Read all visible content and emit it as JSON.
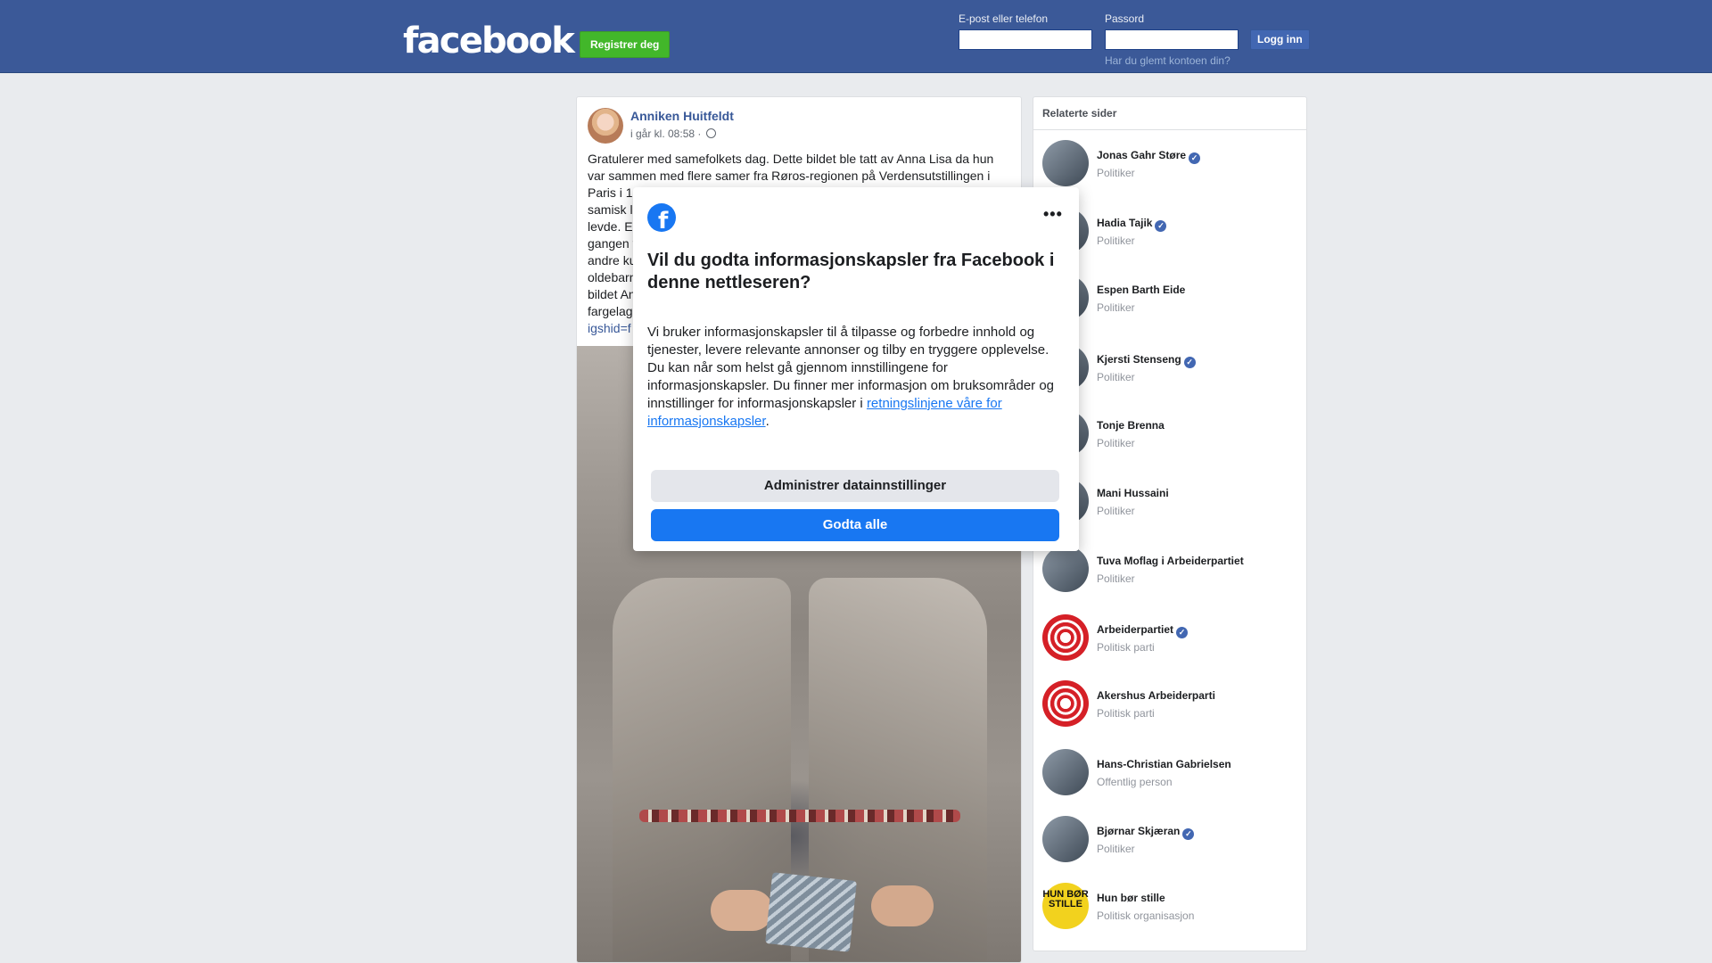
{
  "header": {
    "logo_text": "facebook",
    "register_label": "Registrer deg",
    "email_label": "E-post eller telefon",
    "password_label": "Passord",
    "login_label": "Logg inn",
    "forgot_label": "Har du glemt kontoen din?"
  },
  "post": {
    "author": "Anniken Huitfeldt",
    "time": "i går kl. 08:58 ·",
    "text_visible": "Gratulerer med samefolkets dag. Dette bildet ble tatt av Anna Lisa da hun var sammen med flere samer fra Røros-regionen på Verdensutstillingen i Paris i 18",
    "text_fragments": [
      "samisk l",
      "levde. E",
      "gangen v",
      "andre ku",
      "oldebarn",
      "bildet An",
      "fargelag"
    ],
    "link_fragment": "igshid=f"
  },
  "sidebar": {
    "title": "Relaterte sider",
    "items": [
      {
        "name": "Jonas Gahr Støre",
        "sub": "Politiker",
        "verified": true
      },
      {
        "name": "Hadia Tajik",
        "sub": "Politiker",
        "verified": true
      },
      {
        "name": "Espen Barth Eide",
        "sub": "Politiker",
        "verified": false
      },
      {
        "name": "Kjersti Stenseng",
        "sub": "Politiker",
        "verified": true
      },
      {
        "name": "Tonje Brenna",
        "sub": "Politiker",
        "verified": false
      },
      {
        "name": "Mani Hussaini",
        "sub": "Politiker",
        "verified": false
      },
      {
        "name": "Tuva Moflag i Arbeiderpartiet",
        "sub": "Politiker",
        "verified": false
      },
      {
        "name": "Arbeiderpartiet",
        "sub": "Politisk parti",
        "verified": true
      },
      {
        "name": "Akershus Arbeiderparti",
        "sub": "Politisk parti",
        "verified": false
      },
      {
        "name": "Hans-Christian Gabrielsen",
        "sub": "Offentlig person",
        "verified": false
      },
      {
        "name": "Bjørnar Skjæran",
        "sub": "Politiker",
        "verified": true
      },
      {
        "name": "Hun bør stille",
        "sub": "Politisk organisasjon",
        "verified": false
      }
    ],
    "hun_logo_text": "HUN BØR STILLE"
  },
  "modal": {
    "title": "Vil du godta informasjonskapsler fra Facebook i denne nettleseren?",
    "body": "Vi bruker informasjonskapsler til å tilpasse og forbedre innhold og tjenester, levere relevante annonser og tilby en tryggere opplevelse. Du kan når som helst gå gjennom innstillingene for informasjonskapsler. Du finner mer informasjon om bruksområder og innstillinger for informasjonskapsler i ",
    "link_text": "retningslinjene våre for informasjonskapsler",
    "body_end": ".",
    "manage_label": "Administrer datainnstillinger",
    "accept_label": "Godta alle",
    "more_icon": "•••",
    "fb_glyph": "f"
  },
  "colors": {
    "header_bg": "#3b5998",
    "register_green": "#42b72a",
    "accent_blue": "#1877f2",
    "link_blue": "#385898"
  }
}
